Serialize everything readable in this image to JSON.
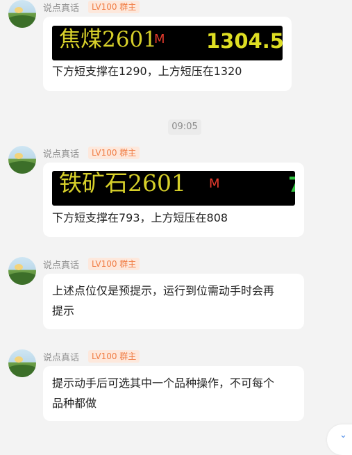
{
  "chat": {
    "time_separator": "09:05",
    "messages": [
      {
        "sender": "说点真话",
        "badge": "LV100 群主",
        "ticker": {
          "symbol": "焦煤2601",
          "marker": "M",
          "price": "1304.5",
          "color": "#d7d02a"
        },
        "text": "下方短支撑在1290，上方短压在1320"
      },
      {
        "sender": "说点真话",
        "badge": "LV100 群主",
        "ticker": {
          "symbol": "铁矿石2601",
          "marker": "M",
          "price": "7",
          "color": "#d7d02a"
        },
        "text": "下方短支撑在793，上方短压在808"
      },
      {
        "sender": "说点真话",
        "badge": "LV100 群主",
        "text_line1": "上述点位仅是预提示，运行到位需动手时会再",
        "text_line2": "提示"
      },
      {
        "sender": "说点真话",
        "badge": "LV100 群主",
        "text_line1": "提示动手后可选其中一个品种操作，不可每个",
        "text_line2": "品种都做"
      }
    ],
    "scroll_down_icon": "chevron-down-icon",
    "accent_color": "#f07c43"
  }
}
